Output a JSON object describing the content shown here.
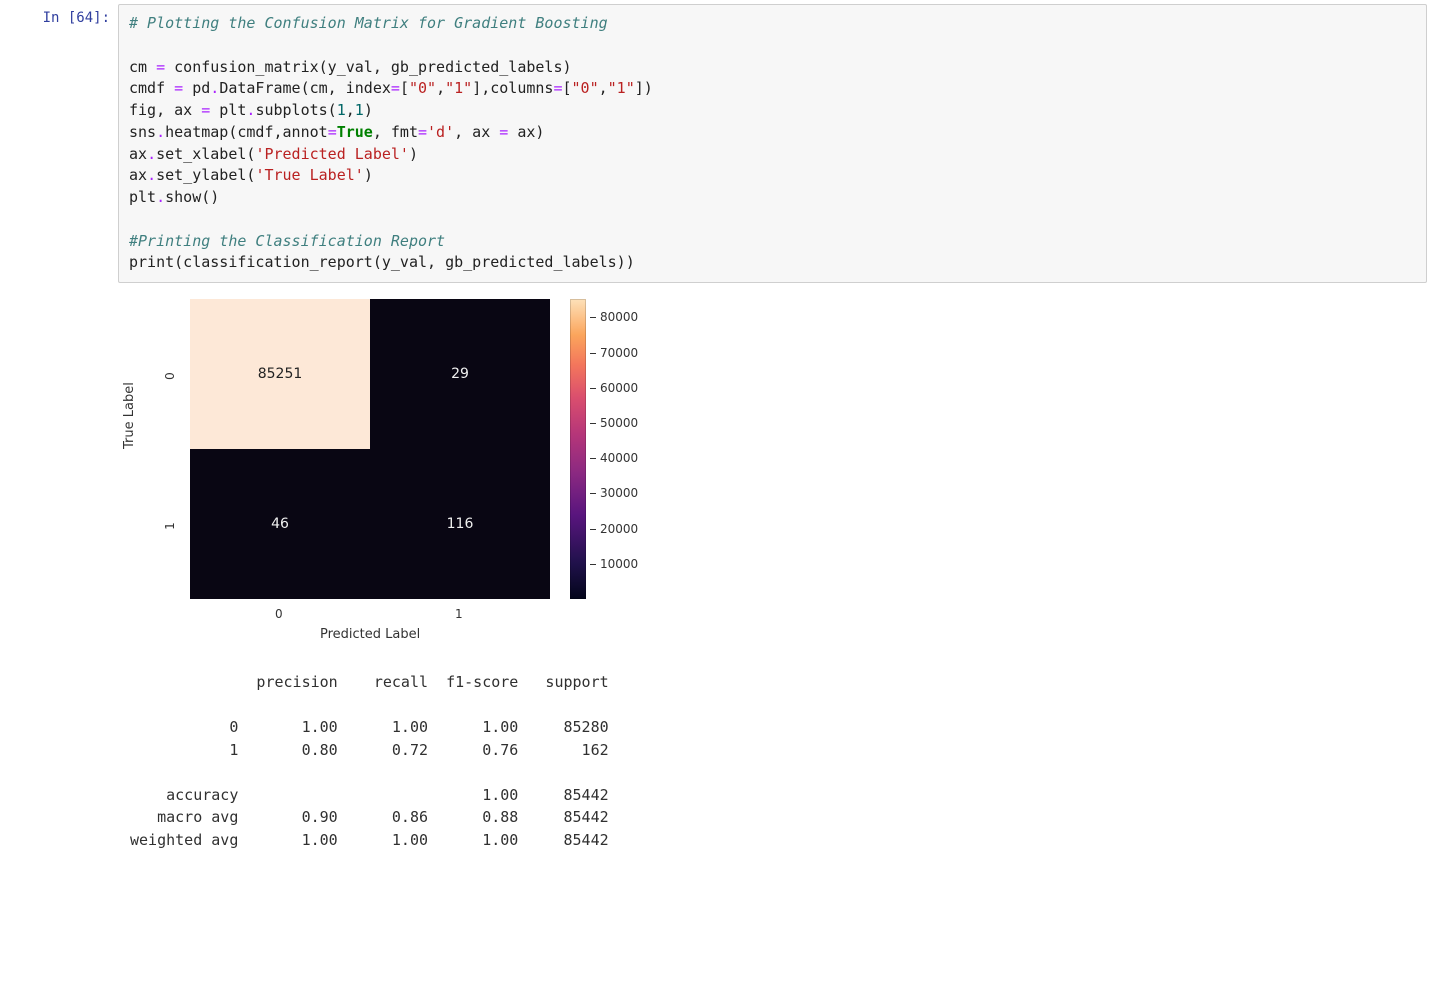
{
  "cell": {
    "prompt": "In [64]:",
    "code": {
      "l1": "# Plotting the Confusion Matrix for Gradient Boosting",
      "l2a": "cm ",
      "l2b": "=",
      "l2c": " confusion_matrix(y_val, gb_predicted_labels)",
      "l3a": "cmdf ",
      "l3b": "=",
      "l3c": " pd",
      "l3d": ".",
      "l3e": "DataFrame(cm, index",
      "l3f": "=",
      "l3g": "[",
      "l3h": "\"0\"",
      "l3i": ",",
      "l3j": "\"1\"",
      "l3k": "],columns",
      "l3l": "=",
      "l3m": "[",
      "l3n": "\"0\"",
      "l3o": ",",
      "l3p": "\"1\"",
      "l3q": "])",
      "l4a": "fig, ax ",
      "l4b": "=",
      "l4c": " plt",
      "l4d": ".",
      "l4e": "subplots(",
      "l4f": "1",
      "l4g": ",",
      "l4h": "1",
      "l4i": ")",
      "l5a": "sns",
      "l5b": ".",
      "l5c": "heatmap(cmdf,annot",
      "l5d": "=",
      "l5e": "True",
      "l5f": ", fmt",
      "l5g": "=",
      "l5h": "'d'",
      "l5i": ", ax ",
      "l5j": "=",
      "l5k": " ax)",
      "l6a": "ax",
      "l6b": ".",
      "l6c": "set_xlabel(",
      "l6d": "'Predicted Label'",
      "l6e": ")",
      "l7a": "ax",
      "l7b": ".",
      "l7c": "set_ylabel(",
      "l7d": "'True Label'",
      "l7e": ")",
      "l8a": "plt",
      "l8b": ".",
      "l8c": "show()",
      "l10": "#Printing the Classification Report",
      "l11a": "print",
      "l11b": "(classification_report(y_val, gb_predicted_labels))"
    }
  },
  "chart_data": {
    "type": "heatmap",
    "title": "",
    "xlabel": "Predicted Label",
    "ylabel": "True Label",
    "x_categories": [
      "0",
      "1"
    ],
    "y_categories": [
      "0",
      "1"
    ],
    "matrix": [
      [
        85251,
        29
      ],
      [
        46,
        116
      ]
    ],
    "cell_labels": {
      "r0c0": "85251",
      "r0c1": "29",
      "r1c0": "46",
      "r1c1": "116"
    },
    "colorbar_ticks": [
      "10000",
      "20000",
      "30000",
      "40000",
      "50000",
      "60000",
      "70000",
      "80000"
    ],
    "colorbar_range": [
      0,
      85251
    ]
  },
  "report_text": "              precision    recall  f1-score   support\n\n           0       1.00      1.00      1.00     85280\n           1       0.80      0.72      0.76       162\n\n    accuracy                           1.00     85442\n   macro avg       0.90      0.86      0.88     85442\nweighted avg       1.00      1.00      1.00     85442",
  "classification_report": {
    "columns": [
      "precision",
      "recall",
      "f1-score",
      "support"
    ],
    "rows": [
      {
        "label": "0",
        "precision": 1.0,
        "recall": 1.0,
        "f1": 1.0,
        "support": 85280
      },
      {
        "label": "1",
        "precision": 0.8,
        "recall": 0.72,
        "f1": 0.76,
        "support": 162
      }
    ],
    "accuracy": {
      "f1": 1.0,
      "support": 85442
    },
    "macro_avg": {
      "precision": 0.9,
      "recall": 0.86,
      "f1": 0.88,
      "support": 85442
    },
    "weighted_avg": {
      "precision": 1.0,
      "recall": 1.0,
      "f1": 1.0,
      "support": 85442
    }
  }
}
